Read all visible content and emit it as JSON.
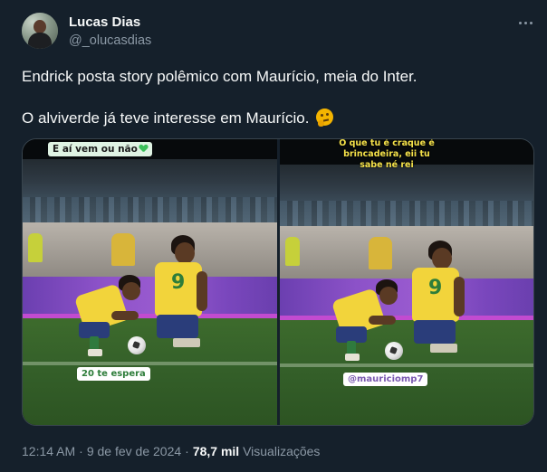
{
  "author": {
    "name": "Lucas Dias",
    "handle": "@_olucasdias"
  },
  "tweet": {
    "line1": "Endrick posta story polêmico com Maurício, meia do Inter.",
    "line2": "O alviverde já teve interesse em Maurício.",
    "emoji": "thinking-face-emoji"
  },
  "media": {
    "left": {
      "caption_top": "E aí vem ou não",
      "caption_bottom": "20 te espera",
      "shirt_number": "9"
    },
    "right": {
      "caption_top": "O que tu é craque é brincadeira, eii tu sabe né rei",
      "caption_bottom": "@mauriciomp7",
      "shirt_number": "9"
    }
  },
  "meta": {
    "time": "12:14 AM",
    "date": "9 de fev de 2024",
    "views_count": "78,7 mil",
    "views_label": "Visualizações"
  },
  "colors": {
    "background": "#15202b",
    "text_primary": "#f7f9f9",
    "text_secondary": "#8b98a5",
    "border": "#38444d",
    "brazil_yellow": "#f2d43b",
    "caption_green": "#3bbf5a"
  }
}
